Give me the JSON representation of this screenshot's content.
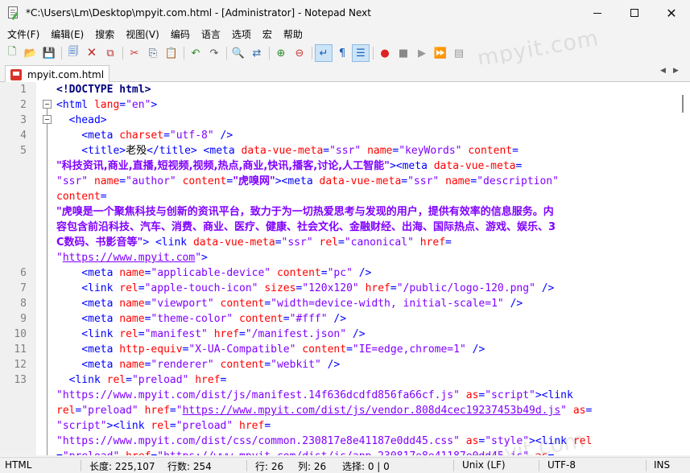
{
  "window": {
    "title": "*C:\\Users\\Lm\\Desktop\\mpyit.com.html - [Administrator] - Notepad Next"
  },
  "menu": [
    "文件(F)",
    "编辑(E)",
    "搜索",
    "视图(V)",
    "编码",
    "语言",
    "选项",
    "宏",
    "帮助"
  ],
  "toolbar": {
    "icons": [
      "new-file-icon",
      "open-folder-icon",
      "save-icon",
      "save-all-icon",
      "close-icon",
      "close-all-icon",
      "cut-icon",
      "copy-icon",
      "paste-icon",
      "undo-icon",
      "redo-icon",
      "find-icon",
      "replace-icon",
      "zoom-in-icon",
      "zoom-out-icon",
      "word-wrap-icon",
      "show-all-chars-icon",
      "indent-guide-icon",
      "record-macro-icon",
      "stop-record-icon",
      "play-macro-icon",
      "run-macro-multiple-icon",
      "save-macro-icon"
    ]
  },
  "watermark": "mpyit.com",
  "tab": {
    "label": "mpyit.com.html"
  },
  "editor": {
    "line_numbers": [
      "1",
      "2",
      "3",
      "4",
      "5",
      "6",
      "7",
      "8",
      "9",
      "10",
      "11",
      "12",
      "13"
    ],
    "lines": [
      [
        {
          "t": "<!DOCTYPE html>",
          "c": "doctype"
        }
      ],
      [
        {
          "t": "<html ",
          "c": "tag"
        },
        {
          "t": "lang",
          "c": "attr"
        },
        {
          "t": "=",
          "c": "tag"
        },
        {
          "t": "\"en\"",
          "c": "val"
        },
        {
          "t": ">",
          "c": "tag"
        }
      ],
      [
        {
          "t": "  <head>",
          "c": "tag"
        }
      ],
      [
        {
          "t": "    <meta ",
          "c": "tag"
        },
        {
          "t": "charset",
          "c": "attr"
        },
        {
          "t": "=",
          "c": "tag"
        },
        {
          "t": "\"utf-8\"",
          "c": "val"
        },
        {
          "t": " />",
          "c": "tag"
        }
      ],
      [
        {
          "t": "    <title>",
          "c": "tag"
        },
        {
          "t": "老殁",
          "c": "txt"
        },
        {
          "t": "</title>",
          "c": "tag"
        },
        {
          "t": " <meta ",
          "c": "tag"
        },
        {
          "t": "data-vue-meta",
          "c": "attr"
        },
        {
          "t": "=",
          "c": "tag"
        },
        {
          "t": "\"ssr\"",
          "c": "val"
        },
        {
          "t": " ",
          "c": "tag"
        },
        {
          "t": "name",
          "c": "attr"
        },
        {
          "t": "=",
          "c": "tag"
        },
        {
          "t": "\"keyWords\"",
          "c": "val"
        },
        {
          "t": " ",
          "c": "tag"
        },
        {
          "t": "content",
          "c": "attr"
        },
        {
          "t": "=",
          "c": "tag"
        }
      ],
      [
        {
          "t": "\"科技资讯,商业,直播,短视频,视频,热点,商业,快讯,播客,讨论,人工智能\"",
          "c": "val zh"
        },
        {
          "t": "><meta ",
          "c": "tag"
        },
        {
          "t": "data-vue-meta",
          "c": "attr"
        },
        {
          "t": "=",
          "c": "tag"
        }
      ],
      [
        {
          "t": "\"ssr\"",
          "c": "val"
        },
        {
          "t": " ",
          "c": "tag"
        },
        {
          "t": "name",
          "c": "attr"
        },
        {
          "t": "=",
          "c": "tag"
        },
        {
          "t": "\"author\"",
          "c": "val"
        },
        {
          "t": " ",
          "c": "tag"
        },
        {
          "t": "content",
          "c": "attr"
        },
        {
          "t": "=",
          "c": "tag"
        },
        {
          "t": "\"虎嗅网\"",
          "c": "val zh"
        },
        {
          "t": "><meta ",
          "c": "tag"
        },
        {
          "t": "data-vue-meta",
          "c": "attr"
        },
        {
          "t": "=",
          "c": "tag"
        },
        {
          "t": "\"ssr\"",
          "c": "val"
        },
        {
          "t": " ",
          "c": "tag"
        },
        {
          "t": "name",
          "c": "attr"
        },
        {
          "t": "=",
          "c": "tag"
        },
        {
          "t": "\"description\"",
          "c": "val"
        }
      ],
      [
        {
          "t": "content",
          "c": "attr"
        },
        {
          "t": "=",
          "c": "tag"
        }
      ],
      [
        {
          "t": "\"虎嗅是一个聚焦科技与创新的资讯平台，致力于为一切热爱思考与发现的用户，提供有效率的信息服务。内",
          "c": "val zh"
        }
      ],
      [
        {
          "t": "容包含前沿科技、汽车、消费、商业、医疗、健康、社会文化、金融财经、出海、国际热点、游戏、娱乐、3",
          "c": "val zh"
        }
      ],
      [
        {
          "t": "C数码、书影音等\"",
          "c": "val zh"
        },
        {
          "t": "> <link ",
          "c": "tag"
        },
        {
          "t": "data-vue-meta",
          "c": "attr"
        },
        {
          "t": "=",
          "c": "tag"
        },
        {
          "t": "\"ssr\"",
          "c": "val"
        },
        {
          "t": " ",
          "c": "tag"
        },
        {
          "t": "rel",
          "c": "attr"
        },
        {
          "t": "=",
          "c": "tag"
        },
        {
          "t": "\"canonical\"",
          "c": "val"
        },
        {
          "t": " ",
          "c": "tag"
        },
        {
          "t": "href",
          "c": "attr"
        },
        {
          "t": "=",
          "c": "tag"
        }
      ],
      [
        {
          "t": "\"",
          "c": "val"
        },
        {
          "t": "https://www.mpyit.com",
          "c": "val link"
        },
        {
          "t": "\"",
          "c": "val"
        },
        {
          "t": ">",
          "c": "tag"
        }
      ],
      [
        {
          "t": "    <meta ",
          "c": "tag"
        },
        {
          "t": "name",
          "c": "attr"
        },
        {
          "t": "=",
          "c": "tag"
        },
        {
          "t": "\"applicable-device\"",
          "c": "val"
        },
        {
          "t": " ",
          "c": "tag"
        },
        {
          "t": "content",
          "c": "attr"
        },
        {
          "t": "=",
          "c": "tag"
        },
        {
          "t": "\"pc\"",
          "c": "val"
        },
        {
          "t": " />",
          "c": "tag"
        }
      ],
      [
        {
          "t": "    <link ",
          "c": "tag"
        },
        {
          "t": "rel",
          "c": "attr"
        },
        {
          "t": "=",
          "c": "tag"
        },
        {
          "t": "\"apple-touch-icon\"",
          "c": "val"
        },
        {
          "t": " ",
          "c": "tag"
        },
        {
          "t": "sizes",
          "c": "attr"
        },
        {
          "t": "=",
          "c": "tag"
        },
        {
          "t": "\"120x120\"",
          "c": "val"
        },
        {
          "t": " ",
          "c": "tag"
        },
        {
          "t": "href",
          "c": "attr"
        },
        {
          "t": "=",
          "c": "tag"
        },
        {
          "t": "\"/public/logo-120.png\"",
          "c": "val"
        },
        {
          "t": " />",
          "c": "tag"
        }
      ],
      [
        {
          "t": "    <meta ",
          "c": "tag"
        },
        {
          "t": "name",
          "c": "attr"
        },
        {
          "t": "=",
          "c": "tag"
        },
        {
          "t": "\"viewport\"",
          "c": "val"
        },
        {
          "t": " ",
          "c": "tag"
        },
        {
          "t": "content",
          "c": "attr"
        },
        {
          "t": "=",
          "c": "tag"
        },
        {
          "t": "\"width=device-width, initial-scale=1\"",
          "c": "val"
        },
        {
          "t": " />",
          "c": "tag"
        }
      ],
      [
        {
          "t": "    <meta ",
          "c": "tag"
        },
        {
          "t": "name",
          "c": "attr"
        },
        {
          "t": "=",
          "c": "tag"
        },
        {
          "t": "\"theme-color\"",
          "c": "val"
        },
        {
          "t": " ",
          "c": "tag"
        },
        {
          "t": "content",
          "c": "attr"
        },
        {
          "t": "=",
          "c": "tag"
        },
        {
          "t": "\"#fff\"",
          "c": "val"
        },
        {
          "t": " />",
          "c": "tag"
        }
      ],
      [
        {
          "t": "    <link ",
          "c": "tag"
        },
        {
          "t": "rel",
          "c": "attr"
        },
        {
          "t": "=",
          "c": "tag"
        },
        {
          "t": "\"manifest\"",
          "c": "val"
        },
        {
          "t": " ",
          "c": "tag"
        },
        {
          "t": "href",
          "c": "attr"
        },
        {
          "t": "=",
          "c": "tag"
        },
        {
          "t": "\"/manifest.json\"",
          "c": "val"
        },
        {
          "t": " />",
          "c": "tag"
        }
      ],
      [
        {
          "t": "    <meta ",
          "c": "tag"
        },
        {
          "t": "http-equiv",
          "c": "attr"
        },
        {
          "t": "=",
          "c": "tag"
        },
        {
          "t": "\"X-UA-Compatible\"",
          "c": "val"
        },
        {
          "t": " ",
          "c": "tag"
        },
        {
          "t": "content",
          "c": "attr"
        },
        {
          "t": "=",
          "c": "tag"
        },
        {
          "t": "\"IE=edge,chrome=1\"",
          "c": "val"
        },
        {
          "t": " />",
          "c": "tag"
        }
      ],
      [
        {
          "t": "    <meta ",
          "c": "tag"
        },
        {
          "t": "name",
          "c": "attr"
        },
        {
          "t": "=",
          "c": "tag"
        },
        {
          "t": "\"renderer\"",
          "c": "val"
        },
        {
          "t": " ",
          "c": "tag"
        },
        {
          "t": "content",
          "c": "attr"
        },
        {
          "t": "=",
          "c": "tag"
        },
        {
          "t": "\"webkit\"",
          "c": "val"
        },
        {
          "t": " />",
          "c": "tag"
        }
      ],
      [
        {
          "t": "  <link ",
          "c": "tag"
        },
        {
          "t": "rel",
          "c": "attr"
        },
        {
          "t": "=",
          "c": "tag"
        },
        {
          "t": "\"preload\"",
          "c": "val"
        },
        {
          "t": " ",
          "c": "tag"
        },
        {
          "t": "href",
          "c": "attr"
        },
        {
          "t": "=",
          "c": "tag"
        }
      ],
      [
        {
          "t": "\"",
          "c": "val"
        },
        {
          "t": "https://www.mpyit.com/dist/js/manifest.14f636dcdfd856fa66cf.js",
          "c": "val"
        },
        {
          "t": "\"",
          "c": "val"
        },
        {
          "t": " ",
          "c": "tag"
        },
        {
          "t": "as",
          "c": "attr"
        },
        {
          "t": "=",
          "c": "tag"
        },
        {
          "t": "\"script\"",
          "c": "val"
        },
        {
          "t": "><link",
          "c": "tag"
        }
      ],
      [
        {
          "t": "rel",
          "c": "attr"
        },
        {
          "t": "=",
          "c": "tag"
        },
        {
          "t": "\"preload\"",
          "c": "val"
        },
        {
          "t": " ",
          "c": "tag"
        },
        {
          "t": "href",
          "c": "attr"
        },
        {
          "t": "=",
          "c": "tag"
        },
        {
          "t": "\"",
          "c": "val"
        },
        {
          "t": "https://www.mpyit.com/dist/js/vendor.808d4cec19237453b49d.js",
          "c": "val link"
        },
        {
          "t": "\"",
          "c": "val"
        },
        {
          "t": " ",
          "c": "tag"
        },
        {
          "t": "as",
          "c": "attr"
        },
        {
          "t": "=",
          "c": "tag"
        }
      ],
      [
        {
          "t": "\"script\"",
          "c": "val"
        },
        {
          "t": "><link ",
          "c": "tag"
        },
        {
          "t": "rel",
          "c": "attr"
        },
        {
          "t": "=",
          "c": "tag"
        },
        {
          "t": "\"preload\"",
          "c": "val"
        },
        {
          "t": " ",
          "c": "tag"
        },
        {
          "t": "href",
          "c": "attr"
        },
        {
          "t": "=",
          "c": "tag"
        }
      ],
      [
        {
          "t": "\"",
          "c": "val"
        },
        {
          "t": "https://www.mpyit.com/dist/css/common.230817e8e41187e0dd45.css",
          "c": "val"
        },
        {
          "t": "\"",
          "c": "val"
        },
        {
          "t": " ",
          "c": "tag"
        },
        {
          "t": "as",
          "c": "attr"
        },
        {
          "t": "=",
          "c": "tag"
        },
        {
          "t": "\"style\"",
          "c": "val"
        },
        {
          "t": "><link ",
          "c": "tag"
        },
        {
          "t": "rel",
          "c": "attr"
        }
      ],
      [
        {
          "t": "=",
          "c": "tag"
        },
        {
          "t": "\"preload\"",
          "c": "val"
        },
        {
          "t": " ",
          "c": "tag"
        },
        {
          "t": "href",
          "c": "attr"
        },
        {
          "t": "=",
          "c": "tag"
        },
        {
          "t": "\"https://www.mpyit.com/dist/js/app.230817e8e41187e0dd45.js\"",
          "c": "val"
        },
        {
          "t": " ",
          "c": "tag"
        },
        {
          "t": "as",
          "c": "attr"
        },
        {
          "t": "=",
          "c": "tag"
        }
      ]
    ]
  },
  "statusbar": {
    "language": "HTML",
    "length": "长度: 225,107",
    "lines": "行数: 254",
    "cursor_line": "行: 26",
    "cursor_col": "列: 26",
    "selection": "选择: 0 | 0",
    "eol": "Unix (LF)",
    "encoding": "UTF-8",
    "mode": "INS"
  }
}
